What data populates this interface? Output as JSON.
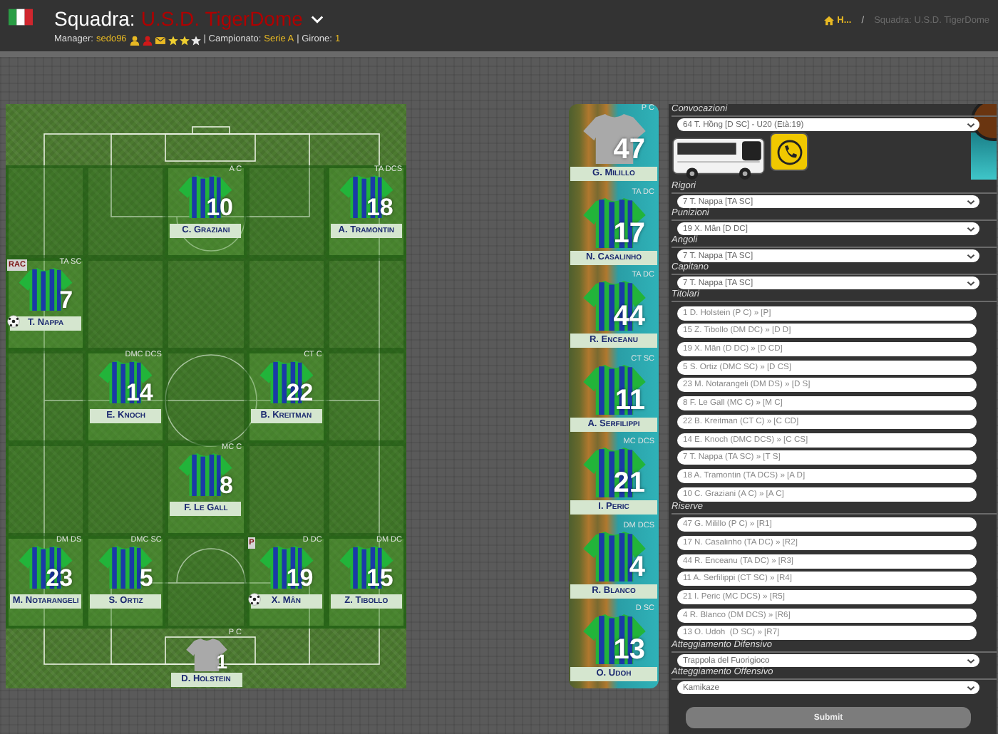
{
  "header": {
    "title_label": "Squadra:",
    "team_name": "U.S.D. TigerDome",
    "manager_label": "Manager:",
    "manager": "sedo96",
    "stars": 2,
    "league_label": "| Campionato:",
    "league": "Serie A",
    "group_label": "| Girone:",
    "group": "1"
  },
  "breadcrumb": {
    "home": "H...",
    "separator": "/",
    "current": "Squadra: U.S.D. TigerDome"
  },
  "pitch": {
    "lines": [
      {
        "zones": [
          {
            "occupied": false
          },
          {
            "occupied": false
          },
          {
            "occupied": true,
            "player": {
              "number": "10",
              "name": "C. Graziani",
              "role": "A C",
              "kind": "outfield",
              "ball": false
            }
          },
          {
            "occupied": false
          },
          {
            "occupied": true,
            "player": {
              "number": "18",
              "name": "A. Tramontin",
              "role": "TA DCS",
              "kind": "outfield",
              "ball": false
            }
          }
        ]
      },
      {
        "zones": [
          {
            "occupied": true,
            "player": {
              "number": "7",
              "name": "T. Nappa",
              "role": "TA SC",
              "kind": "outfield",
              "ball": true,
              "tag": "RAC"
            }
          },
          {
            "occupied": false
          },
          {
            "occupied": false
          },
          {
            "occupied": false
          },
          {
            "occupied": false
          }
        ]
      },
      {
        "zones": [
          {
            "occupied": false
          },
          {
            "occupied": true,
            "player": {
              "number": "14",
              "name": "E. Knoch",
              "role": "DMC DCS",
              "kind": "outfield",
              "ball": false
            }
          },
          {
            "occupied": false
          },
          {
            "occupied": true,
            "player": {
              "number": "22",
              "name": "B. Kreitman",
              "role": "CT C",
              "kind": "outfield",
              "ball": false
            }
          },
          {
            "occupied": false
          }
        ]
      },
      {
        "zones": [
          {
            "occupied": false
          },
          {
            "occupied": false
          },
          {
            "occupied": true,
            "player": {
              "number": "8",
              "name": "F. Le Gall",
              "role": "MC C",
              "kind": "outfield",
              "ball": false
            }
          },
          {
            "occupied": false
          },
          {
            "occupied": false
          }
        ]
      },
      {
        "zones": [
          {
            "occupied": true,
            "player": {
              "number": "23",
              "name": "M. Notarangeli",
              "role": "DM DS",
              "kind": "outfield",
              "ball": false
            }
          },
          {
            "occupied": true,
            "player": {
              "number": "5",
              "name": "S. Ortiz",
              "role": "DMC SC",
              "kind": "outfield",
              "ball": false
            }
          },
          {
            "occupied": false
          },
          {
            "occupied": true,
            "player": {
              "number": "19",
              "name": "X. Mân",
              "role": "D DC",
              "kind": "outfield",
              "ball": true,
              "tag": "P"
            }
          },
          {
            "occupied": true,
            "player": {
              "number": "15",
              "name": "Z. Tibollo",
              "role": "DM DC",
              "kind": "outfield",
              "ball": false
            }
          }
        ]
      }
    ],
    "goalkeeper": {
      "number": "1",
      "name": "D. Holstein",
      "role": "P C",
      "kind": "goalkeeper",
      "ball": false
    }
  },
  "bench": [
    {
      "number": "47",
      "name": "G. Milillo",
      "role": "P C",
      "kind": "goalkeeper"
    },
    {
      "number": "17",
      "name": "N. Casalinho",
      "role": "TA DC",
      "kind": "outfield"
    },
    {
      "number": "44",
      "name": "R. Enceanu",
      "role": "TA DC",
      "kind": "outfield"
    },
    {
      "number": "11",
      "name": "A. Serfilippi",
      "role": "CT SC",
      "kind": "outfield"
    },
    {
      "number": "21",
      "name": "I. Peric",
      "role": "MC DCS",
      "kind": "outfield"
    },
    {
      "number": "4",
      "name": "R. Blanco",
      "role": "DM DCS",
      "kind": "outfield"
    },
    {
      "number": "13",
      "name": "O. Udoh",
      "role": "D SC",
      "kind": "outfield"
    }
  ],
  "form": {
    "call_up": {
      "label": "Convocazioni",
      "value": "64 T. Hồng [D SC] - U20 (Età:19)"
    },
    "set_pieces": [
      {
        "label": "Rigori",
        "value": "7 T. Nappa [TA SC]"
      },
      {
        "label": "Punizioni",
        "value": "19 X. Mân [D DC]"
      },
      {
        "label": "Angoli",
        "value": "7 T. Nappa [TA SC]"
      },
      {
        "label": "Capitano",
        "value": "7 T. Nappa [TA SC]"
      }
    ],
    "starters": {
      "label": "Titolari",
      "values": [
        "1 D. Holstein (P C) » [P]",
        "15 Z. Tibollo (DM DC) » [D D]",
        "19 X. Mân (D DC) » [D CD]",
        "5 S. Ortiz (DMC SC) » [D CS]",
        "23 M. Notarangeli (DM DS) » [D S]",
        "8 F. Le Gall (MC C) » [M C]",
        "22 B. Kreitman (CT C) » [C CD]",
        "14 E. Knoch (DMC DCS) » [C CS]",
        "7 T. Nappa (TA SC) » [T S]",
        "18 A. Tramontin (TA DCS) » [A D]",
        "10 C. Graziani (A C) » [A C]"
      ]
    },
    "reserves": {
      "label": "Riserve",
      "values": [
        "47 G. Milillo (P C) » [R1]",
        "17 N. Casalinho (TA DC) » [R2]",
        "44 R. Enceanu (TA DC) » [R3]",
        "11 A. Serfilippi (CT SC) » [R4]",
        "21 I. Peric (MC DCS) » [R5]",
        "4 R. Blanco (DM DCS) » [R6]",
        "13 O. Udoh  (D SC) » [R7]"
      ]
    },
    "attitudes": [
      {
        "label": "Atteggiamento Difensivo",
        "value": "Trappola del Fuorigioco"
      },
      {
        "label": "Atteggiamento Offensivo",
        "value": "Kamikaze"
      }
    ],
    "submit": "Submit"
  }
}
